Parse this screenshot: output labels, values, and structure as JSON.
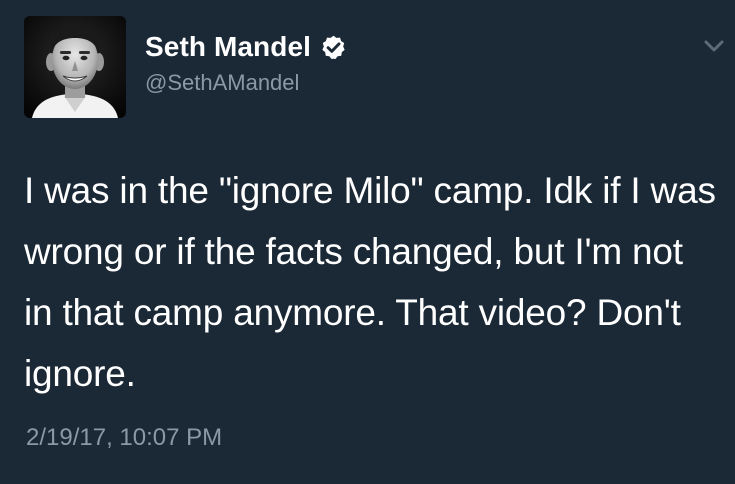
{
  "tweet": {
    "author": {
      "display_name": "Seth Mandel",
      "handle": "@SethAMandel",
      "verified": true,
      "avatar_icon": "profile-photo"
    },
    "text": "I was in the \"ignore Milo\" camp. Idk if I was wrong or if the facts changed, but I'm not in that camp anymore. That video? Don't ignore.",
    "timestamp": "2/19/17, 10:07 PM",
    "menu_icon": "chevron-down-icon"
  },
  "colors": {
    "background": "#1b2836",
    "primary_text": "#ffffff",
    "secondary_text": "#8b98a5",
    "verified_badge": "#ffffff"
  }
}
